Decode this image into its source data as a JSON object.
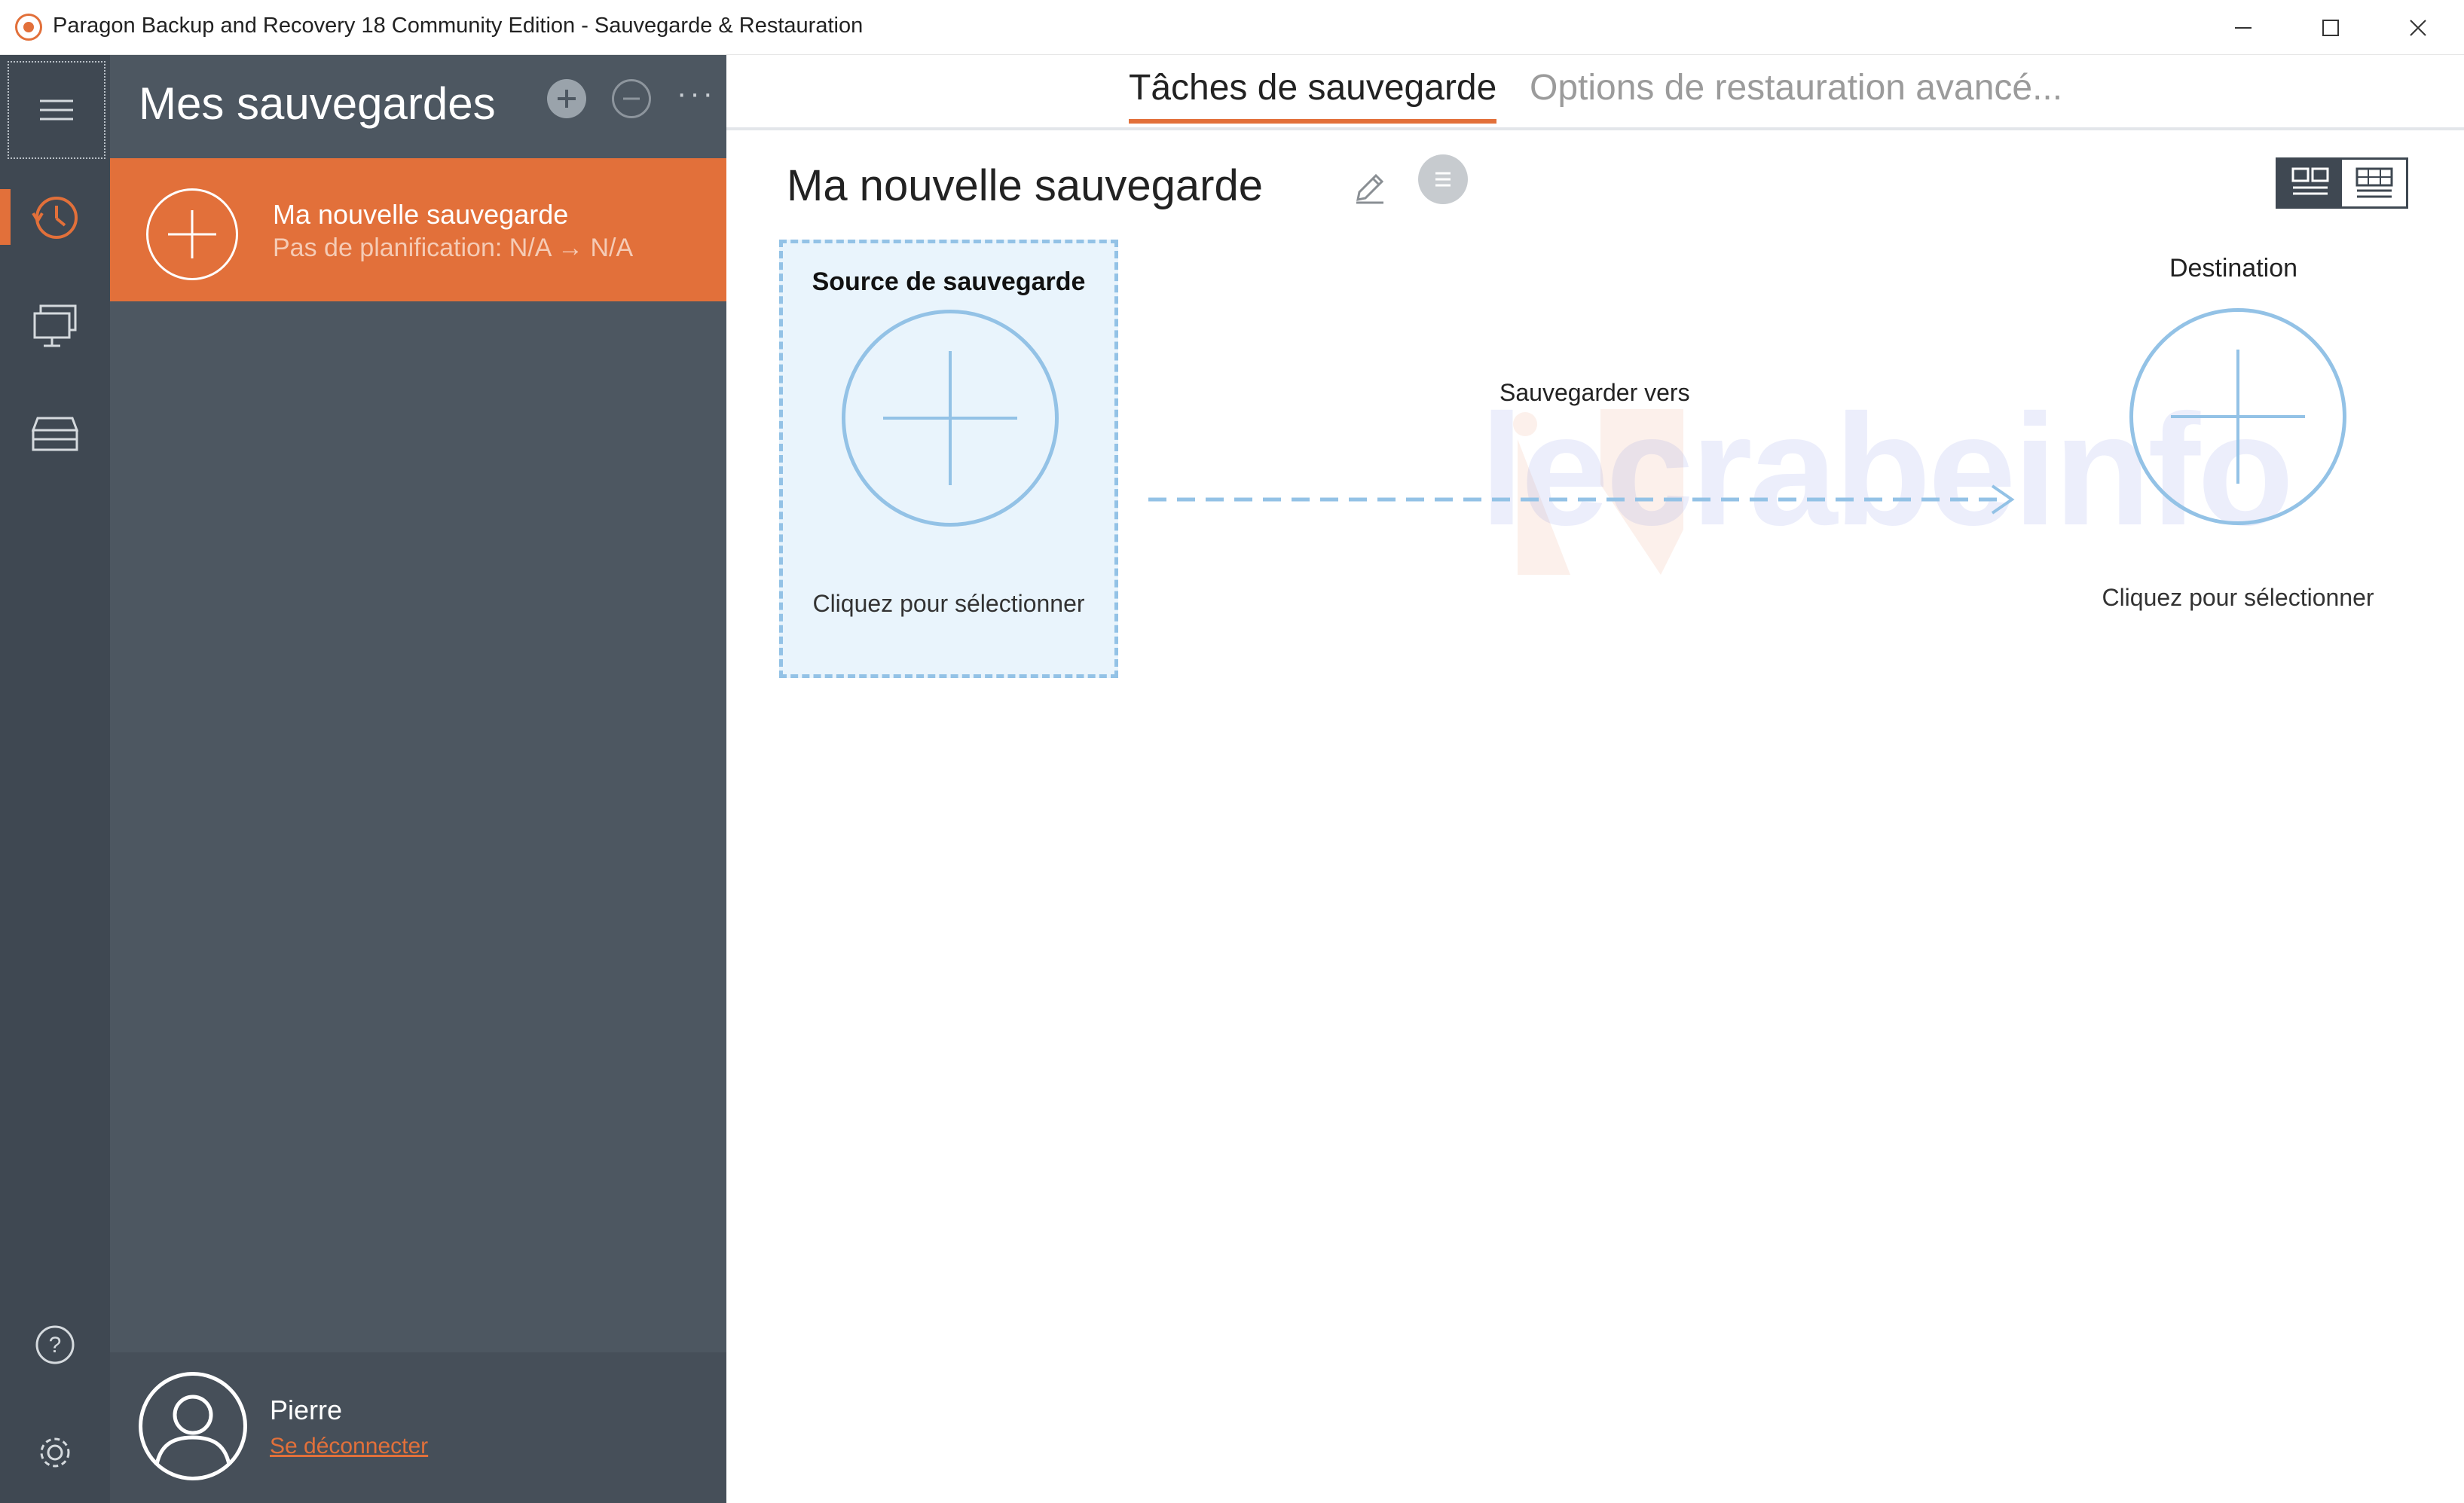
{
  "window": {
    "title": "Paragon Backup and Recovery 18 Community Edition - Sauvegarde & Restauration"
  },
  "sidebar": {
    "title": "Mes sauvegardes",
    "items": [
      {
        "name": "Ma nouvelle sauvegarde",
        "schedule": "Pas de planification: N/A → N/A"
      }
    ]
  },
  "user": {
    "name": "Pierre",
    "logout_label": "Se déconnecter"
  },
  "tabs": [
    {
      "label": "Tâches de sauvegarde",
      "active": true
    },
    {
      "label": "Options de restauration avancé...",
      "active": false
    }
  ],
  "backup": {
    "title": "Ma nouvelle sauvegarde",
    "source": {
      "label": "Source de sauvegarde",
      "hint": "Cliquez pour sélectionner"
    },
    "flow_label": "Sauvegarder vers",
    "destination": {
      "label": "Destination",
      "hint": "Cliquez pour sélectionner"
    }
  },
  "watermark": "lecrabeinfo",
  "colors": {
    "accent": "#e2703a",
    "rail": "#3f4852",
    "panel": "#4d5761",
    "selection_border": "#93c2e6",
    "selection_fill": "#e9f4fc"
  },
  "icons": {
    "rail": [
      "menu-icon",
      "backup-clock-icon",
      "computers-icon",
      "storage-icon",
      "help-icon",
      "settings-icon"
    ],
    "panel": [
      "add-icon",
      "remove-icon",
      "more-icon"
    ],
    "main": [
      "pencil-icon",
      "description-icon",
      "tile-view-icon",
      "list-view-icon"
    ]
  }
}
